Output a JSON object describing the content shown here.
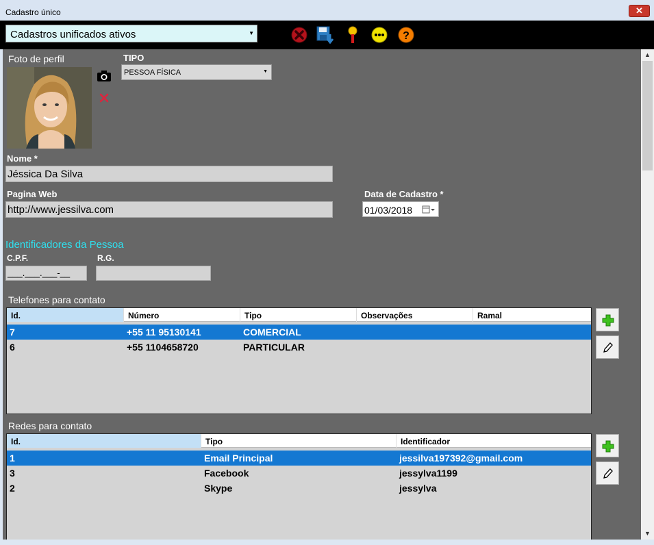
{
  "window": {
    "title": "Cadastro único",
    "close_glyph": "✕"
  },
  "toolbar": {
    "combo_value": "Cadastros unificados ativos",
    "icons": [
      "delete-icon",
      "save-icon",
      "pin-icon",
      "more-icon",
      "help-icon"
    ]
  },
  "profile": {
    "photo_label": "Foto de perfil"
  },
  "tipo": {
    "label": "TIPO",
    "value": "PESSOA FÍSICA"
  },
  "nome": {
    "label": "Nome *",
    "value": "Jéssica Da Silva"
  },
  "pagina": {
    "label": "Pagina Web",
    "value": "http://www.jessilva.com"
  },
  "data_cadastro": {
    "label": "Data de Cadastro *",
    "value": "01/03/2018"
  },
  "identificadores": {
    "section_label": "Identificadores da Pessoa",
    "cpf_label": "C.P.F.",
    "cpf_mask": "___.___.___-__",
    "rg_label": "R.G.",
    "rg_value": ""
  },
  "telefones": {
    "section_label": "Telefones para contato",
    "columns": [
      "Id.",
      "Número",
      "Tipo",
      "Observações",
      "Ramal"
    ],
    "rows": [
      {
        "id": "7",
        "numero": "+55 11 95130141",
        "tipo": "COMERCIAL",
        "obs": "",
        "ramal": ""
      },
      {
        "id": "6",
        "numero": "+55 1104658720",
        "tipo": "PARTICULAR",
        "obs": "",
        "ramal": ""
      }
    ]
  },
  "redes": {
    "section_label": "Redes para contato",
    "columns": [
      "Id.",
      "Tipo",
      "Identificador"
    ],
    "rows": [
      {
        "id": "1",
        "tipo": "Email Principal",
        "identificador": "jessilva197392@gmail.com"
      },
      {
        "id": "3",
        "tipo": "Facebook",
        "identificador": "jessylva1199"
      },
      {
        "id": "2",
        "tipo": "Skype",
        "identificador": "jessylva"
      }
    ]
  },
  "colors": {
    "selected_row": "#1478d2",
    "accent_label": "#2fe0ee",
    "panel_bg": "#676767"
  }
}
